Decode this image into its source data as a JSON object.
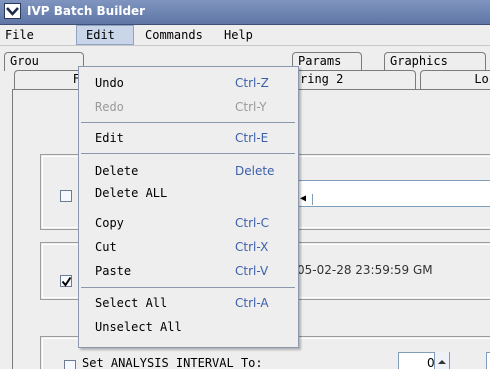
{
  "window": {
    "title": "IVP Batch Builder"
  },
  "menubar": {
    "items": [
      "File",
      "Edit",
      "Commands",
      "Help"
    ]
  },
  "tabs": {
    "row1": [
      "Grou",
      "Params",
      "Graphics"
    ],
    "row2": [
      "F",
      "ring 2",
      "Loc"
    ]
  },
  "content": {
    "timestamp": "05-02-28 23:59:59 GM",
    "interval_label": "Set ANALYSIS INTERVAL To:",
    "interval_value": "0"
  },
  "edit_menu": {
    "items": [
      {
        "label": "Undo",
        "accel": "Ctrl-Z",
        "enabled": true
      },
      {
        "label": "Redo",
        "accel": "Ctrl-Y",
        "enabled": false
      },
      {
        "label": "Edit",
        "accel": "Ctrl-E",
        "enabled": true
      },
      {
        "label": "Delete",
        "accel": "Delete",
        "enabled": true
      },
      {
        "label": "Delete ALL",
        "accel": "",
        "enabled": true
      },
      {
        "label": "Copy",
        "accel": "Ctrl-C",
        "enabled": true
      },
      {
        "label": "Cut",
        "accel": "Ctrl-X",
        "enabled": true
      },
      {
        "label": "Paste",
        "accel": "Ctrl-V",
        "enabled": true
      },
      {
        "label": "Select All",
        "accel": "Ctrl-A",
        "enabled": true
      },
      {
        "label": "Unselect All",
        "accel": "",
        "enabled": true
      }
    ]
  },
  "colors": {
    "titlebar": "#6a80ad",
    "menu_highlight": "#c9d6e9",
    "accelerator": "#3c5faa"
  }
}
